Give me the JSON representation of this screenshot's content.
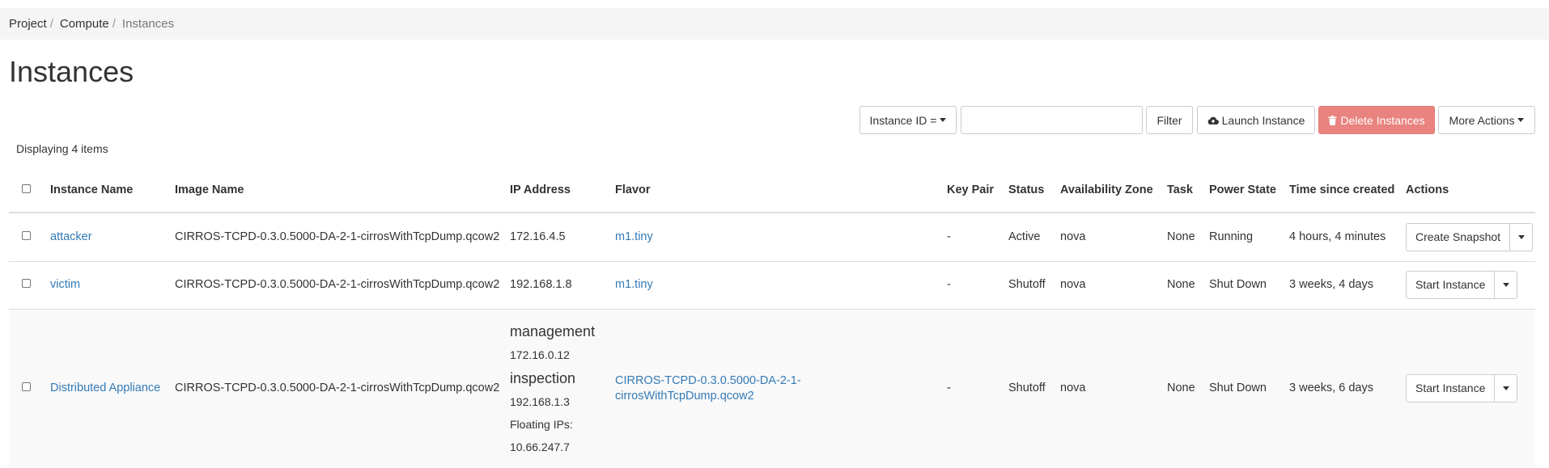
{
  "breadcrumb": {
    "items": [
      "Project",
      "Compute"
    ],
    "current": "Instances"
  },
  "page": {
    "title": "Instances"
  },
  "toolbar": {
    "filter_field": "Instance ID =",
    "search_value": "",
    "filter_label": "Filter",
    "launch_label": "Launch Instance",
    "delete_label": "Delete Instances",
    "more_label": "More Actions"
  },
  "icons": {
    "launch": "cloud-upload-icon",
    "delete": "trash-icon"
  },
  "colors": {
    "link": "#337ab7",
    "danger": "#e8837f",
    "breadcrumb_bg": "#f5f5f5",
    "stripe": "#f9f9f9"
  },
  "table": {
    "count": "Displaying 4 items",
    "headers": {
      "name": "Instance Name",
      "image": "Image Name",
      "ip": "IP Address",
      "flavor": "Flavor",
      "keypair": "Key Pair",
      "status": "Status",
      "az": "Availability Zone",
      "task": "Task",
      "power": "Power State",
      "time": "Time since created",
      "actions": "Actions"
    },
    "rows": [
      {
        "name": "attacker",
        "image": "CIRROS-TCPD-0.3.0.5000-DA-2-1-cirrosWithTcpDump.qcow2",
        "ip": "172.16.4.5",
        "flavor": "m1.tiny",
        "keypair": "-",
        "status": "Active",
        "az": "nova",
        "task": "None",
        "power": "Running",
        "time": "4 hours, 4 minutes",
        "action": "Create Snapshot"
      },
      {
        "name": "victim",
        "image": "CIRROS-TCPD-0.3.0.5000-DA-2-1-cirrosWithTcpDump.qcow2",
        "ip": "192.168.1.8",
        "flavor": "m1.tiny",
        "keypair": "-",
        "status": "Shutoff",
        "az": "nova",
        "task": "None",
        "power": "Shut Down",
        "time": "3 weeks, 4 days",
        "action": "Start Instance"
      },
      {
        "name": "Distributed Appliance",
        "image": "CIRROS-TCPD-0.3.0.5000-DA-2-1-cirrosWithTcpDump.qcow2",
        "ip_networks": [
          {
            "net": "management",
            "ip": "172.16.0.12"
          },
          {
            "net": "inspection",
            "ip": "192.168.1.3"
          }
        ],
        "floating_label": "Floating IPs:",
        "floating_ip": "10.66.247.7",
        "flavor": "CIRROS-TCPD-0.3.0.5000-DA-2-1-cirrosWithTcpDump.qcow2",
        "keypair": "-",
        "status": "Shutoff",
        "az": "nova",
        "task": "None",
        "power": "Shut Down",
        "time": "3 weeks, 6 days",
        "action": "Start Instance"
      }
    ]
  }
}
